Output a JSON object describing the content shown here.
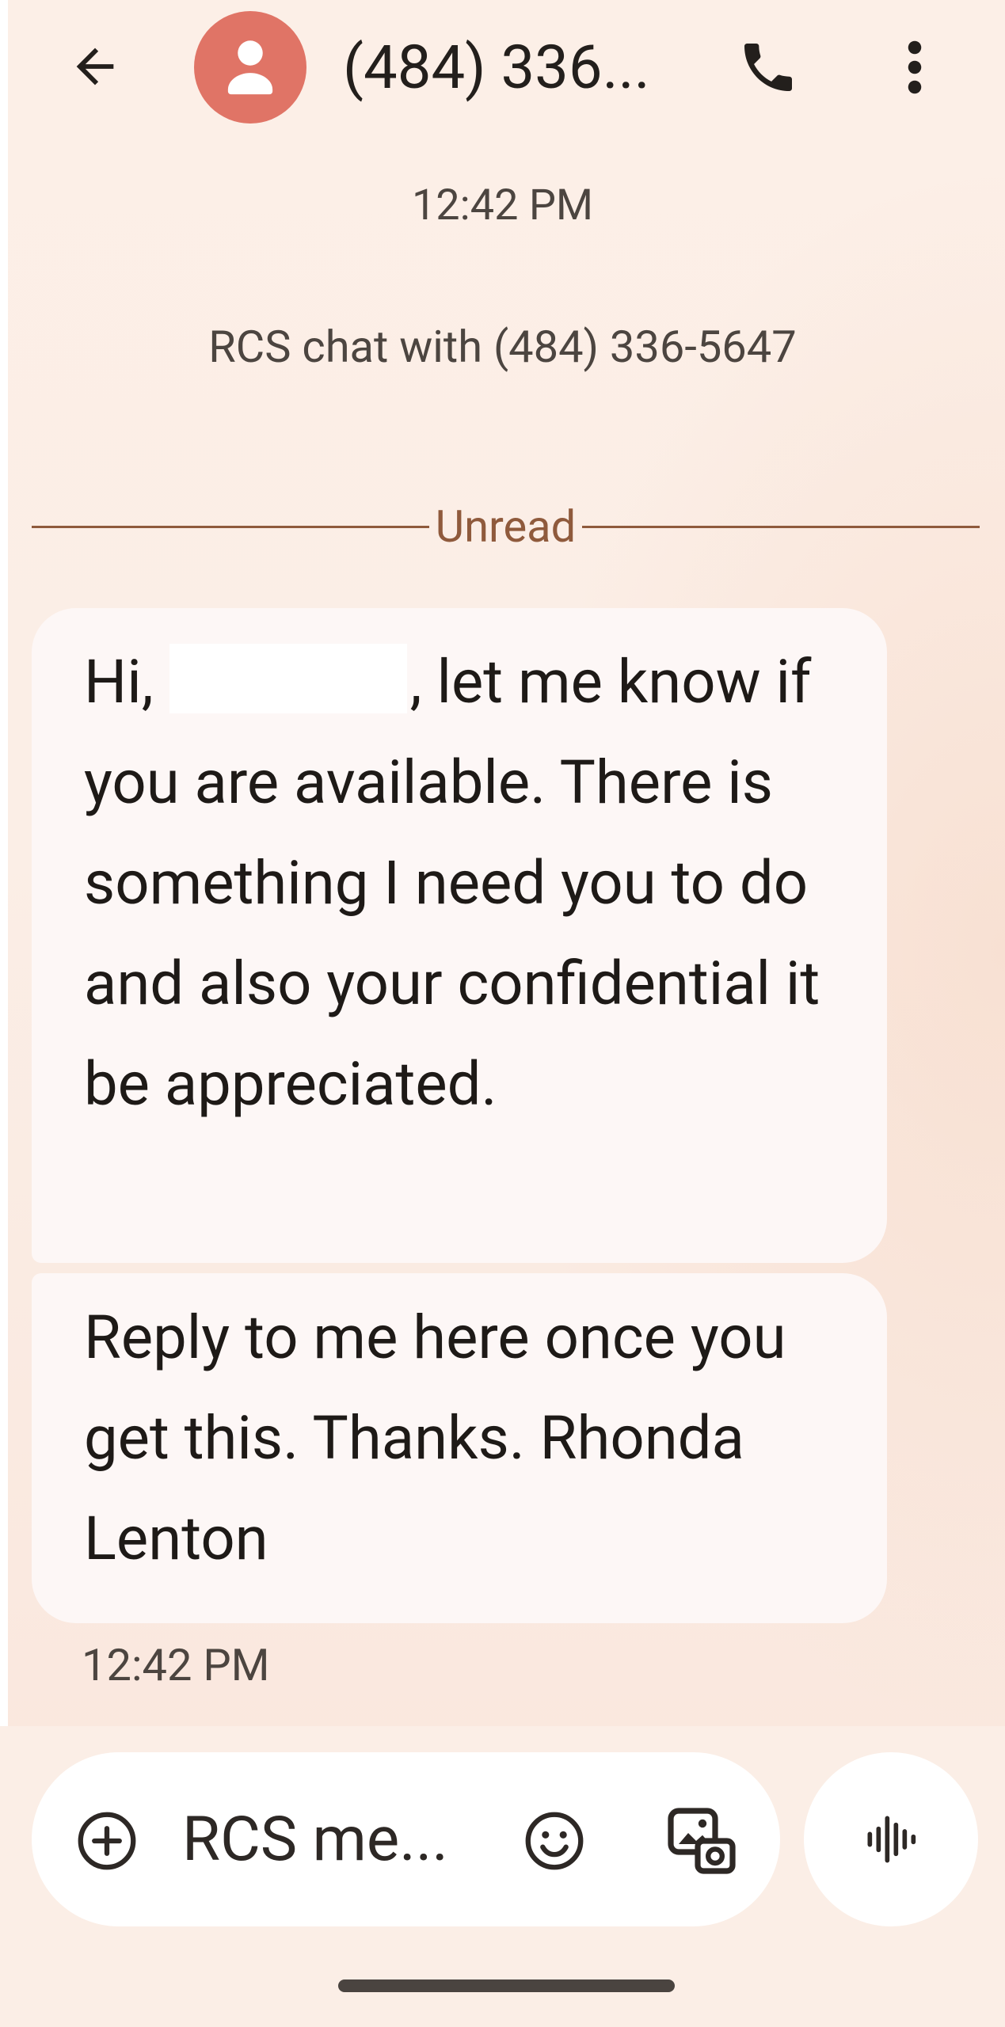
{
  "header": {
    "title": "(484) 336...",
    "back_icon": "arrow-left-icon",
    "avatar_icon": "person-icon",
    "call_icon": "phone-icon",
    "menu_icon": "more-vertical-icon"
  },
  "conversation": {
    "top_timestamp": "12:42 PM",
    "rcs_notice": "RCS chat with (484) 336-5647",
    "unread_label": "Unread",
    "messages": [
      {
        "greeting": "Hi,",
        "text": ", let me know if you are available. There is something I need you to do and also your confidential it be appreciated."
      },
      {
        "text": "Reply to me here once you get this. Thanks. Rhonda Lenton"
      }
    ],
    "bottom_timestamp": "12:42 PM"
  },
  "compose": {
    "placeholder": "RCS me...",
    "add_icon": "add-circle-icon",
    "emoji_icon": "emoji-icon",
    "gallery_icon": "gallery-icon",
    "voice_icon": "voice-waveform-icon"
  },
  "colors": {
    "background": "#fbeee6",
    "avatar": "#e07466",
    "bubble": "#fdf7f6",
    "unread_accent": "#8f5a3c"
  }
}
